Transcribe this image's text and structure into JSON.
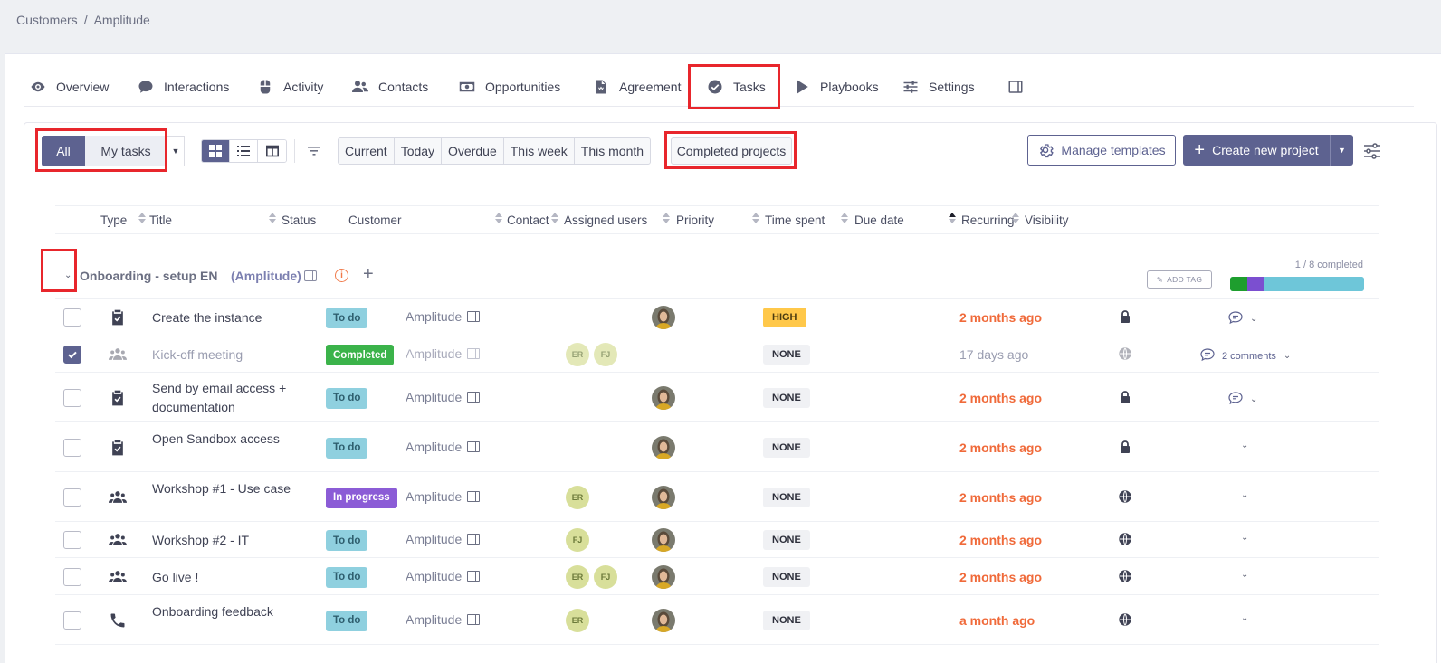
{
  "breadcrumb": {
    "root": "Customers",
    "separator": "/",
    "current": "Amplitude"
  },
  "tabs": [
    {
      "id": "overview",
      "label": "Overview",
      "icon": "eye-icon"
    },
    {
      "id": "interactions",
      "label": "Interactions",
      "icon": "chat-icon"
    },
    {
      "id": "activity",
      "label": "Activity",
      "icon": "mouse-icon"
    },
    {
      "id": "contacts",
      "label": "Contacts",
      "icon": "users-icon"
    },
    {
      "id": "opportunities",
      "label": "Opportunities",
      "icon": "money-icon"
    },
    {
      "id": "agreement",
      "label": "Agreement",
      "icon": "document-icon"
    },
    {
      "id": "tasks",
      "label": "Tasks",
      "icon": "check-circle-icon",
      "active": true
    },
    {
      "id": "playbooks",
      "label": "Playbooks",
      "icon": "play-icon"
    },
    {
      "id": "settings",
      "label": "Settings",
      "icon": "sliders-icon"
    }
  ],
  "toolbar": {
    "scope_all": "All",
    "scope_my": "My tasks",
    "periods": [
      "Current",
      "Today",
      "Overdue",
      "This week",
      "This month"
    ],
    "completed_projects": "Completed projects",
    "manage_templates": "Manage templates",
    "create_project": "Create new project"
  },
  "columns": [
    "Type",
    "Title",
    "Status",
    "Customer",
    "Contact",
    "Assigned users",
    "Priority",
    "Time spent",
    "Due date",
    "Recurring",
    "Visibility"
  ],
  "group": {
    "title": "Onboarding - setup EN",
    "customer": "(Amplitude)",
    "info": "i",
    "add_tag": "ADD TAG",
    "progress_label": "1 / 8 completed",
    "progress_segments": [
      {
        "color": "#1e9e2e",
        "fraction": 0.125
      },
      {
        "color": "#7b4fd0",
        "fraction": 0.125
      },
      {
        "color": "#6ec6d9",
        "fraction": 0.75
      }
    ]
  },
  "rows": [
    {
      "title": "Create the instance",
      "type": "task",
      "status": "To do",
      "status_kind": "todo",
      "customer": "Amplitude",
      "contacts": [],
      "assigned_photo": true,
      "priority": "HIGH",
      "priority_kind": "high",
      "due": "2 months ago",
      "due_kind": "overdue",
      "visibility": "lock",
      "checked": false,
      "comments": ""
    },
    {
      "title": "Kick-off meeting",
      "type": "meeting",
      "status": "Completed",
      "status_kind": "completed",
      "customer": "Amplitude",
      "contacts": [
        "ER",
        "FJ"
      ],
      "assigned_photo": false,
      "priority": "NONE",
      "priority_kind": "none",
      "due": "17 days ago",
      "due_kind": "past",
      "visibility": "globe",
      "checked": true,
      "comments": "2 comments"
    },
    {
      "title": "Send by email access + documentation",
      "type": "task",
      "status": "To do",
      "status_kind": "todo",
      "customer": "Amplitude",
      "contacts": [],
      "assigned_photo": true,
      "priority": "NONE",
      "priority_kind": "none",
      "due": "2 months ago",
      "due_kind": "overdue",
      "visibility": "lock",
      "checked": false,
      "comments": ""
    },
    {
      "title": "Open Sandbox access",
      "type": "task",
      "status": "To do",
      "status_kind": "todo",
      "customer": "Amplitude",
      "contacts": [],
      "assigned_photo": true,
      "priority": "NONE",
      "priority_kind": "none",
      "due": "2 months ago",
      "due_kind": "overdue",
      "visibility": "lock",
      "checked": false,
      "comments": ""
    },
    {
      "title": "Workshop #1 - Use case",
      "type": "meeting",
      "status": "In progress",
      "status_kind": "inprog",
      "customer": "Amplitude",
      "contacts": [
        "ER"
      ],
      "assigned_photo": true,
      "priority": "NONE",
      "priority_kind": "none",
      "due": "2 months ago",
      "due_kind": "overdue",
      "visibility": "globe",
      "checked": false,
      "comments": ""
    },
    {
      "title": "Workshop #2 - IT",
      "type": "meeting",
      "status": "To do",
      "status_kind": "todo",
      "customer": "Amplitude",
      "contacts": [
        "FJ"
      ],
      "assigned_photo": true,
      "priority": "NONE",
      "priority_kind": "none",
      "due": "2 months ago",
      "due_kind": "overdue",
      "visibility": "globe",
      "checked": false,
      "comments": ""
    },
    {
      "title": "Go live !",
      "type": "meeting",
      "status": "To do",
      "status_kind": "todo",
      "customer": "Amplitude",
      "contacts": [
        "ER",
        "FJ"
      ],
      "assigned_photo": true,
      "priority": "NONE",
      "priority_kind": "none",
      "due": "2 months ago",
      "due_kind": "overdue",
      "visibility": "globe",
      "checked": false,
      "comments": ""
    },
    {
      "title": "Onboarding feedback",
      "type": "call",
      "status": "To do",
      "status_kind": "todo",
      "customer": "Amplitude",
      "contacts": [
        "ER"
      ],
      "assigned_photo": true,
      "priority": "NONE",
      "priority_kind": "none",
      "due": "a month ago",
      "due_kind": "overdue",
      "visibility": "globe",
      "checked": false,
      "comments": ""
    }
  ]
}
